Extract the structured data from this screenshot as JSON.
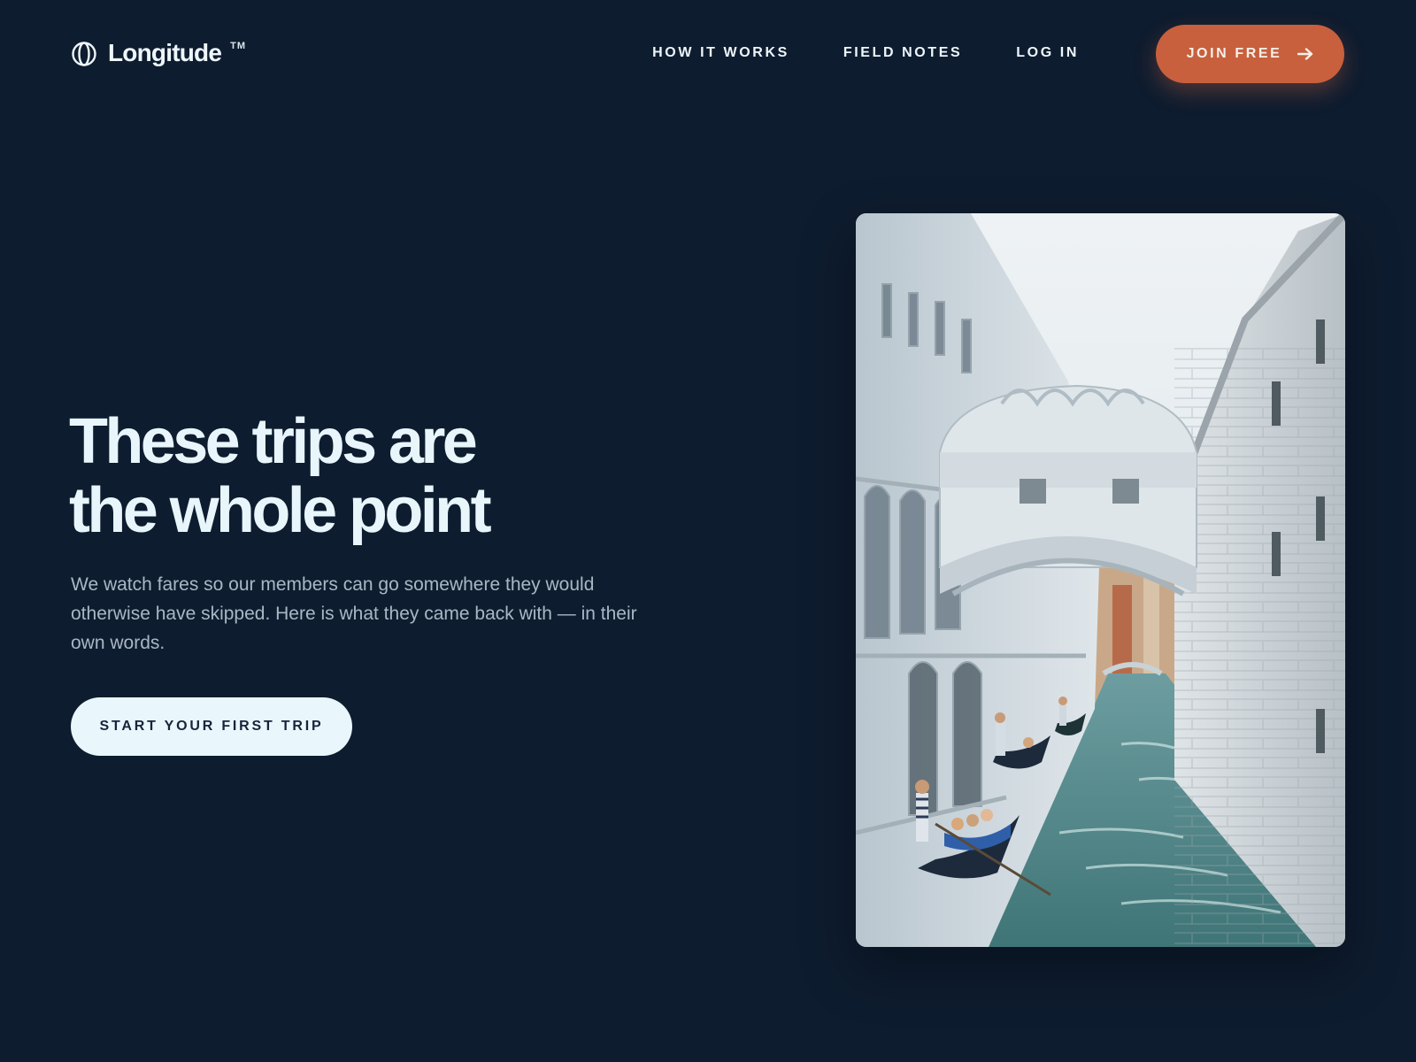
{
  "brand": {
    "name": "Longitude",
    "trademark": "TM",
    "logo_icon": "globe-ring-icon"
  },
  "nav": {
    "items": [
      {
        "label": "HOW IT WORKS"
      },
      {
        "label": "FIELD NOTES"
      },
      {
        "label": "LOG IN"
      }
    ],
    "join_label": "JOIN FREE",
    "join_icon": "arrow-right-icon"
  },
  "hero": {
    "headline_line1": "These trips are",
    "headline_line2": "the whole point",
    "subtitle": "We watch fares so our members can go somewhere they would otherwise have skipped. Here is what they came back with — in their own words.",
    "cta_label": "START YOUR FIRST TRIP"
  },
  "photo": {
    "subject": "Bridge of Sighs over a Venice canal with gondolas"
  },
  "colors": {
    "background": "#0e1c2f",
    "accent": "#c8603d",
    "cta_background": "#e9f7fc",
    "headline": "#e8f6fc",
    "body_text": "#a9b7c5"
  }
}
